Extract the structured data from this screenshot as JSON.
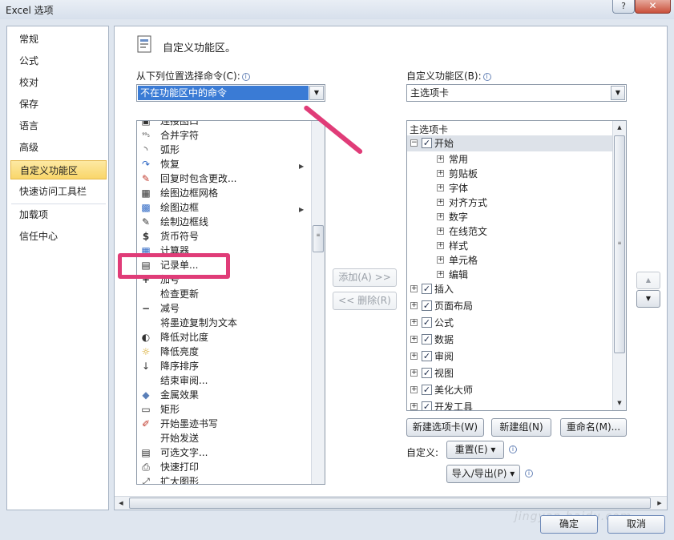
{
  "window": {
    "title": "Excel 选项",
    "help_label": "?",
    "close_label": "✕"
  },
  "nav": {
    "items": [
      {
        "label": "常规"
      },
      {
        "label": "公式"
      },
      {
        "label": "校对"
      },
      {
        "label": "保存"
      },
      {
        "label": "语言"
      },
      {
        "label": "高级"
      },
      {
        "label": "自定义功能区",
        "selected": true
      },
      {
        "label": "快速访问工具栏"
      },
      {
        "label": "加载项"
      },
      {
        "label": "信任中心"
      }
    ]
  },
  "header": {
    "title": "自定义功能区。"
  },
  "left_panel": {
    "choose_label": "从下列位置选择命令(C):",
    "choose_value": "不在功能区中的命令",
    "commands": [
      {
        "label": "连接图口",
        "icon": "▣"
      },
      {
        "label": "合并字符",
        "icon": "⁹⁹₅"
      },
      {
        "label": "弧形",
        "icon": "◝"
      },
      {
        "label": "恢复",
        "icon": "↷",
        "submenu": true
      },
      {
        "label": "回复时包含更改...",
        "icon": "✎"
      },
      {
        "label": "绘图边框网格",
        "icon": "▦"
      },
      {
        "label": "绘图边框",
        "icon": "▩",
        "submenu": true
      },
      {
        "label": "绘制边框线",
        "icon": "✎"
      },
      {
        "label": "货币符号",
        "icon": "$"
      },
      {
        "label": "计算器",
        "icon": "▦"
      },
      {
        "label": "记录单...",
        "icon": "▤"
      },
      {
        "label": "加号",
        "icon": "+"
      },
      {
        "label": "检查更新",
        "icon": ""
      },
      {
        "label": "减号",
        "icon": "−"
      },
      {
        "label": "将墨迹复制为文本",
        "icon": ""
      },
      {
        "label": "降低对比度",
        "icon": "◐"
      },
      {
        "label": "降低亮度",
        "icon": "☼"
      },
      {
        "label": "降序排序",
        "icon": "↓"
      },
      {
        "label": "结束审阅...",
        "icon": ""
      },
      {
        "label": "金属效果",
        "icon": "◆"
      },
      {
        "label": "矩形",
        "icon": "▭"
      },
      {
        "label": "开始墨迹书写",
        "icon": "✐"
      },
      {
        "label": "开始发送",
        "icon": ""
      },
      {
        "label": "可选文字...",
        "icon": "▤"
      },
      {
        "label": "快速打印",
        "icon": "⎙"
      },
      {
        "label": "扩大图形",
        "icon": "⤢"
      }
    ]
  },
  "middle": {
    "add_label": "添加(A) >>",
    "remove_label": "<< 删除(R)"
  },
  "right_panel": {
    "customize_label": "自定义功能区(B):",
    "customize_value": "主选项卡",
    "tree_header": "主选项卡",
    "tree": [
      {
        "label": "开始",
        "level": 0,
        "expander": "⊟",
        "checkbox": true,
        "highlight": true
      },
      {
        "label": "常用",
        "level": 1,
        "expander": "⊞"
      },
      {
        "label": "剪贴板",
        "level": 1,
        "expander": "⊞"
      },
      {
        "label": "字体",
        "level": 1,
        "expander": "⊞"
      },
      {
        "label": "对齐方式",
        "level": 1,
        "expander": "⊞"
      },
      {
        "label": "数字",
        "level": 1,
        "expander": "⊞"
      },
      {
        "label": "在线范文",
        "level": 1,
        "expander": "⊞"
      },
      {
        "label": "样式",
        "level": 1,
        "expander": "⊞"
      },
      {
        "label": "单元格",
        "level": 1,
        "expander": "⊞"
      },
      {
        "label": "编辑",
        "level": 1,
        "expander": "⊞"
      },
      {
        "label": "插入",
        "level": 0,
        "expander": "⊞",
        "checkbox": true
      },
      {
        "label": "页面布局",
        "level": 0,
        "expander": "⊞",
        "checkbox": true
      },
      {
        "label": "公式",
        "level": 0,
        "expander": "⊞",
        "checkbox": true
      },
      {
        "label": "数据",
        "level": 0,
        "expander": "⊞",
        "checkbox": true
      },
      {
        "label": "审阅",
        "level": 0,
        "expander": "⊞",
        "checkbox": true
      },
      {
        "label": "视图",
        "level": 0,
        "expander": "⊞",
        "checkbox": true
      },
      {
        "label": "美化大师",
        "level": 0,
        "expander": "⊞",
        "checkbox": true
      },
      {
        "label": "开发工具",
        "level": 0,
        "expander": "⊞",
        "checkbox": true
      }
    ],
    "new_tab_label": "新建选项卡(W)",
    "new_group_label": "新建组(N)",
    "rename_label": "重命名(M)...",
    "customize_text": "自定义:",
    "reset_label": "重置(E) ▾",
    "import_export_label": "导入/导出(P) ▾"
  },
  "footer": {
    "ok_label": "确定",
    "cancel_label": "取消",
    "watermark": "jingyan.baidu.com"
  },
  "colors": {
    "annotation": "#e03c78",
    "selection": "#3a7bd5",
    "nav_selected": "#f9d66a"
  }
}
